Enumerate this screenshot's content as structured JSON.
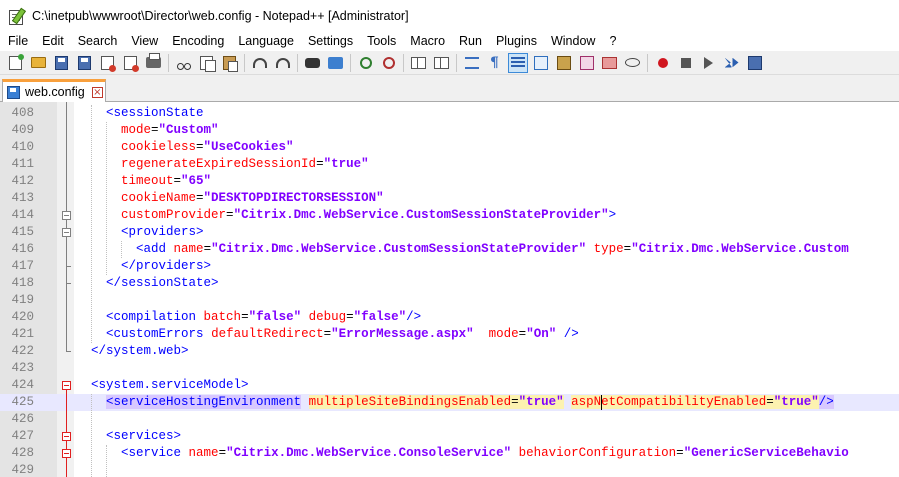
{
  "window": {
    "title": "C:\\inetpub\\wwwroot\\Director\\web.config - Notepad++ [Administrator]"
  },
  "menu": [
    "File",
    "Edit",
    "Search",
    "View",
    "Encoding",
    "Language",
    "Settings",
    "Tools",
    "Macro",
    "Run",
    "Plugins",
    "Window",
    "?"
  ],
  "toolbar": {
    "buttons": [
      "new-file-icon",
      "open-folder-icon",
      "save-icon",
      "save-all-icon",
      "close-icon",
      "close-all-icon",
      "print-icon",
      "cut-icon",
      "copy-icon",
      "paste-icon",
      "undo-icon",
      "redo-icon",
      "find-icon",
      "replace-icon",
      "zoom-in-icon",
      "zoom-out-icon",
      "sync-vertical-icon",
      "sync-horizontal-icon",
      "word-wrap-icon",
      "show-all-chars-icon",
      "indent-guide-icon",
      "user-language-icon",
      "doc-map-icon",
      "function-list-icon",
      "folder-workspace-icon",
      "monitoring-icon",
      "macro-record-icon",
      "macro-stop-icon",
      "macro-play-icon",
      "macro-play-multiple-icon",
      "macro-save-icon"
    ],
    "active": "indent-guide-icon"
  },
  "tabs": [
    {
      "label": "web.config",
      "active": true
    }
  ],
  "colors": {
    "tag": "#0000ff",
    "attribute": "#ff0000",
    "value": "#8000ff",
    "current_line": "#e8e8ff",
    "tab_accent": "#f9a03c"
  },
  "editor": {
    "lines": [
      {
        "n": "408",
        "text": "    <sessionState"
      },
      {
        "n": "409",
        "text": "      mode=\"Custom\""
      },
      {
        "n": "410",
        "text": "      cookieless=\"UseCookies\""
      },
      {
        "n": "411",
        "text": "      regenerateExpiredSessionId=\"true\""
      },
      {
        "n": "412",
        "text": "      timeout=\"65\""
      },
      {
        "n": "413",
        "text": "      cookieName=\"DESKTOPDIRECTORSESSION\""
      },
      {
        "n": "414",
        "text": "      customProvider=\"Citrix.Dmc.WebService.CustomSessionStateProvider\">"
      },
      {
        "n": "415",
        "text": "      <providers>"
      },
      {
        "n": "416",
        "text": "        <add name=\"Citrix.Dmc.WebService.CustomSessionStateProvider\" type=\"Citrix.Dmc.WebService.Custom"
      },
      {
        "n": "417",
        "text": "      </providers>"
      },
      {
        "n": "418",
        "text": "    </sessionState>"
      },
      {
        "n": "419",
        "text": ""
      },
      {
        "n": "420",
        "text": "    <compilation batch=\"false\" debug=\"false\"/>"
      },
      {
        "n": "421",
        "text": "    <customErrors defaultRedirect=\"ErrorMessage.aspx\"  mode=\"On\" />"
      },
      {
        "n": "422",
        "text": "  </system.web>"
      },
      {
        "n": "423",
        "text": ""
      },
      {
        "n": "424",
        "text": "  <system.serviceModel>"
      },
      {
        "n": "425",
        "text": "    <serviceHostingEnvironment multipleSiteBindingsEnabled=\"true\" aspNetCompatibilityEnabled=\"true\"/>"
      },
      {
        "n": "426",
        "text": ""
      },
      {
        "n": "427",
        "text": "    <services>"
      },
      {
        "n": "428",
        "text": "      <service name=\"Citrix.Dmc.WebService.ConsoleService\" behaviorConfiguration=\"GenericServiceBehavio"
      },
      {
        "n": "429",
        "text": ""
      }
    ]
  }
}
